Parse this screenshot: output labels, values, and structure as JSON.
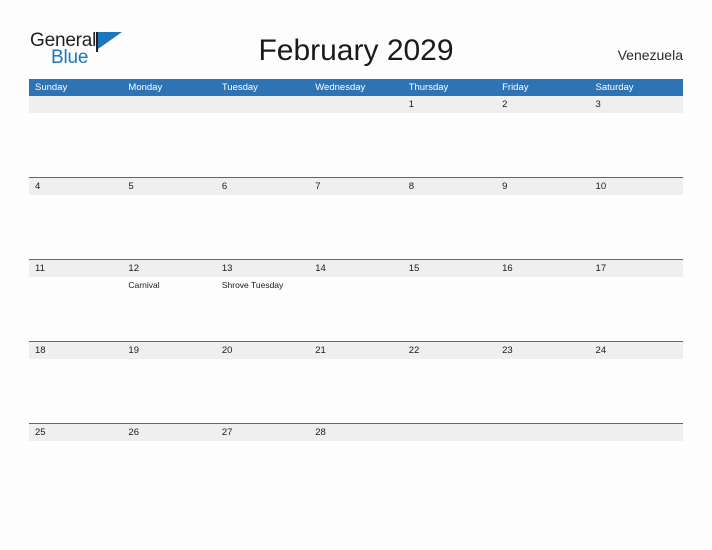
{
  "brand": {
    "name_part1": "General",
    "name_part2": "Blue",
    "primary_color": "#1c76bc",
    "logo_icon": "flag-triangle-icon"
  },
  "header": {
    "title": "February 2029",
    "month": "February",
    "year": "2029",
    "location": "Venezuela"
  },
  "calendar": {
    "header_color": "#2e74b5",
    "date_band_color": "#efefef",
    "weekdays": [
      "Sunday",
      "Monday",
      "Tuesday",
      "Wednesday",
      "Thursday",
      "Friday",
      "Saturday"
    ],
    "weeks": [
      {
        "dates": [
          "",
          "",
          "",
          "",
          "1",
          "2",
          "3"
        ],
        "events": [
          "",
          "",
          "",
          "",
          "",
          "",
          ""
        ]
      },
      {
        "dates": [
          "4",
          "5",
          "6",
          "7",
          "8",
          "9",
          "10"
        ],
        "events": [
          "",
          "",
          "",
          "",
          "",
          "",
          ""
        ]
      },
      {
        "dates": [
          "11",
          "12",
          "13",
          "14",
          "15",
          "16",
          "17"
        ],
        "events": [
          "",
          "Carnival",
          "Shrove Tuesday",
          "",
          "",
          "",
          ""
        ]
      },
      {
        "dates": [
          "18",
          "19",
          "20",
          "21",
          "22",
          "23",
          "24"
        ],
        "events": [
          "",
          "",
          "",
          "",
          "",
          "",
          ""
        ]
      },
      {
        "dates": [
          "25",
          "26",
          "27",
          "28",
          "",
          "",
          ""
        ],
        "events": [
          "",
          "",
          "",
          "",
          "",
          "",
          ""
        ]
      }
    ]
  }
}
